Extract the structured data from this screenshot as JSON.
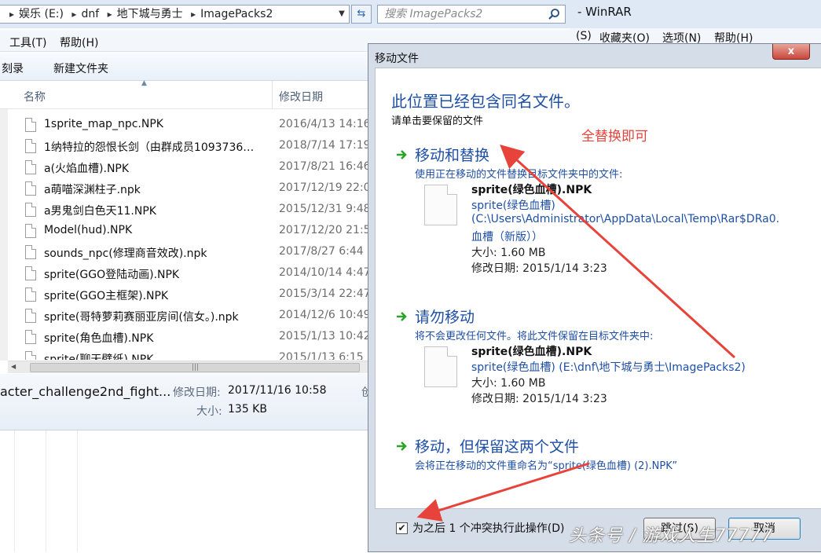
{
  "explorer": {
    "breadcrumbs": [
      "娱乐 (E:)",
      "dnf",
      "地下城与勇士",
      "ImagePacks2"
    ],
    "search_placeholder": "搜索 ImagePacks2",
    "menu": [
      "工具(T)",
      "帮助(H)"
    ],
    "toolbar": [
      "刻录",
      "新建文件夹"
    ],
    "columns": {
      "name": "名称",
      "modified": "修改日期"
    },
    "files": [
      {
        "name": "1sprite_map_npc.NPK",
        "date": "2016/4/13 14:16"
      },
      {
        "name": "1纳特拉的怨恨长剑（由群成员1093736…",
        "date": "2018/7/14 17:19"
      },
      {
        "name": "a(火焰血槽).NPK",
        "date": "2017/8/21 16:46"
      },
      {
        "name": "a萌喵深渊柱子.npk",
        "date": "2017/12/19 22:0"
      },
      {
        "name": "a男鬼剑白色天11.NPK",
        "date": "2015/12/31 9:48"
      },
      {
        "name": "Model(hud).NPK",
        "date": "2017/12/20 21:5"
      },
      {
        "name": "sounds_npc(修理商音效改).npk",
        "date": "2017/8/27 6:44"
      },
      {
        "name": "sprite(GGO登陆动画).NPK",
        "date": "2014/10/14 4:47"
      },
      {
        "name": "sprite(GGO主框架).NPK",
        "date": "2015/3/14 22:47"
      },
      {
        "name": "sprite(哥特萝莉赛丽亚房间(信女。).npk",
        "date": "2014/12/6 10:49"
      },
      {
        "name": "sprite(角色血槽).NPK",
        "date": "2015/1/13 10:42"
      },
      {
        "name": "sprite(聊天壁纸).NPK",
        "date": "2015/1/13 6:15"
      }
    ],
    "details": {
      "filename": "acter_challenge2nd_fight...",
      "modified_label": "修改日期:",
      "modified_value": "2017/11/16 10:58",
      "size_label": "大小:",
      "size_value": "135 KB",
      "cut_char": "创"
    }
  },
  "winrar": {
    "title": "- WinRAR",
    "menu": [
      "(S)",
      "收藏夹(O)",
      "选项(N)",
      "帮助(H)"
    ]
  },
  "dialog": {
    "title": "移动文件",
    "close": "x",
    "heading": "此位置已经包含同名文件。",
    "subheading": "请单击要保留的文件",
    "annotation": "全替换即可",
    "options": [
      {
        "title": "移动和替换",
        "desc": "使用正在移动的文件替换目标文件夹中的文件:",
        "file_name": "sprite(绿色血槽).NPK",
        "path_lines": [
          "sprite(绿色血槽)",
          "(C:\\Users\\Administrator\\AppData\\Local\\Temp\\Rar$DRa0.",
          "血槽（新版））"
        ],
        "size": "大小: 1.60 MB",
        "modified": "修改日期: 2015/1/14 3:23"
      },
      {
        "title": "请勿移动",
        "desc": "将不会更改任何文件。将此文件保留在目标文件夹中:",
        "file_name": "sprite(绿色血槽).NPK",
        "path_lines": [
          "sprite(绿色血槽) (E:\\dnf\\地下城与勇士\\ImagePacks2)"
        ],
        "size": "大小: 1.60 MB",
        "modified": "修改日期: 2015/1/14 3:23"
      },
      {
        "title": "移动，但保留这两个文件",
        "desc": "会将正在移动的文件重命名为“sprite(绿色血槽) (2).NPK”"
      }
    ],
    "checkbox_label": "为之后 1 个冲突执行此操作(D)",
    "checkbox_checked": true,
    "buttons": {
      "skip": "跳过(S)",
      "cancel": "取消"
    }
  },
  "watermark": "头条号 / 游戏人生77777",
  "colors": {
    "accent_link": "#1e4fa5",
    "annotation_red": "#e8433a",
    "arrow_green": "#2aa52a"
  }
}
